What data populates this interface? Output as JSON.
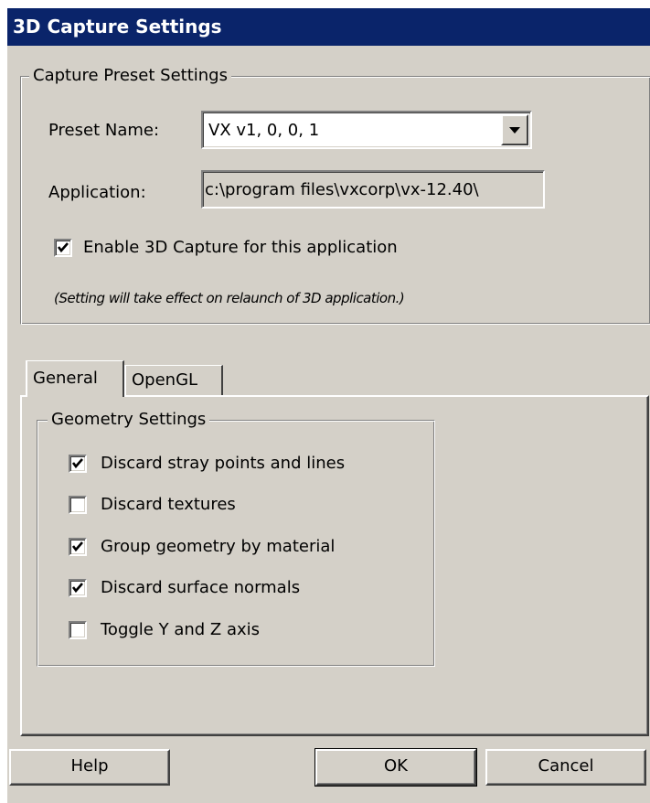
{
  "window": {
    "title": "3D Capture Settings"
  },
  "preset_group": {
    "legend": "Capture Preset Settings",
    "preset_name_label": "Preset Name:",
    "preset_name_value": "VX v1, 0, 0, 1",
    "application_label": "Application:",
    "application_value": "c:\\program files\\vxcorp\\vx-12.40\\",
    "enable_label": "Enable 3D Capture for this application",
    "enable_checked": true,
    "note": "(Setting will take effect on relaunch of 3D application.)"
  },
  "tabs": [
    {
      "label": "General",
      "selected": true
    },
    {
      "label": "OpenGL",
      "selected": false
    }
  ],
  "geometry_group": {
    "legend": "Geometry Settings",
    "options": [
      {
        "label": "Discard stray points and lines",
        "checked": true
      },
      {
        "label": "Discard textures",
        "checked": false
      },
      {
        "label": "Group geometry by material",
        "checked": true
      },
      {
        "label": "Discard surface normals",
        "checked": true
      },
      {
        "label": "Toggle Y and Z axis",
        "checked": false
      }
    ]
  },
  "buttons": {
    "help": "Help",
    "ok": "OK",
    "cancel": "Cancel"
  },
  "icons": {
    "dropdown": "chevron-down-icon",
    "check": "checkmark-icon"
  },
  "colors": {
    "titlebar": "#0a246a",
    "face": "#d4d0c8"
  }
}
